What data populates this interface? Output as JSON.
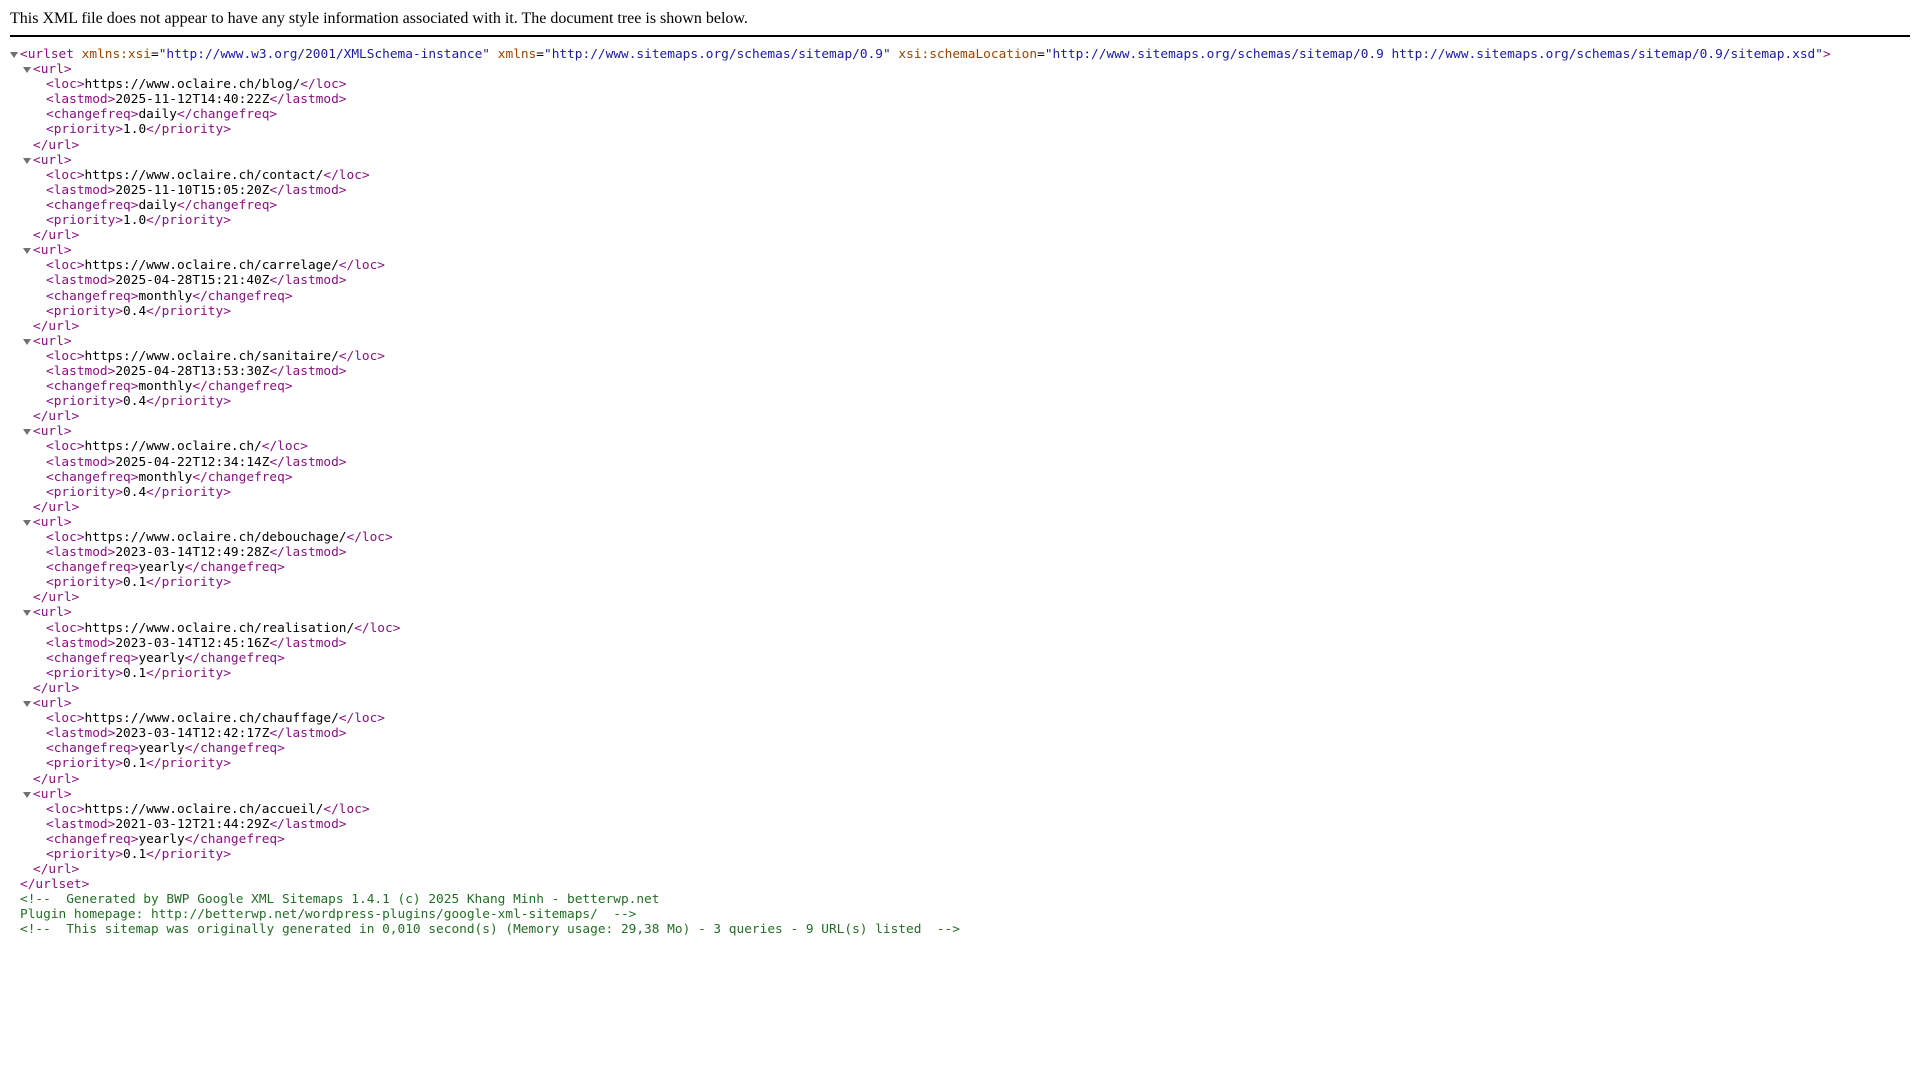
{
  "header": {
    "message": "This XML file does not appear to have any style information associated with it. The document tree is shown below."
  },
  "colors": {
    "tag": "#881280",
    "attribute_name": "#994500",
    "attribute_value": "#1a1aa6",
    "comment": "#236e25",
    "toggle": "#707070"
  },
  "icons": {
    "toggle": "disclosure-triangle-down"
  },
  "urlset": {
    "open_tag": "<urlset",
    "close_tag": "</urlset>",
    "attributes": [
      {
        "name": "xmlns:xsi",
        "value": "\"http://www.w3.org/2001/XMLSchema-instance\""
      },
      {
        "name": "xmlns",
        "value": "\"http://www.sitemaps.org/schemas/sitemap/0.9\""
      },
      {
        "name": "xsi:schemaLocation",
        "value": "\"http://www.sitemaps.org/schemas/sitemap/0.9 http://www.sitemaps.org/schemas/sitemap/0.9/sitemap.xsd\""
      }
    ]
  },
  "urls": [
    {
      "loc": "https://www.oclaire.ch/blog/",
      "lastmod": "2025-11-12T14:40:22Z",
      "changefreq": "daily",
      "priority": "1.0"
    },
    {
      "loc": "https://www.oclaire.ch/contact/",
      "lastmod": "2025-11-10T15:05:20Z",
      "changefreq": "daily",
      "priority": "1.0"
    },
    {
      "loc": "https://www.oclaire.ch/carrelage/",
      "lastmod": "2025-04-28T15:21:40Z",
      "changefreq": "monthly",
      "priority": "0.4"
    },
    {
      "loc": "https://www.oclaire.ch/sanitaire/",
      "lastmod": "2025-04-28T13:53:30Z",
      "changefreq": "monthly",
      "priority": "0.4"
    },
    {
      "loc": "https://www.oclaire.ch/",
      "lastmod": "2025-04-22T12:34:14Z",
      "changefreq": "monthly",
      "priority": "0.4"
    },
    {
      "loc": "https://www.oclaire.ch/debouchage/",
      "lastmod": "2023-03-14T12:49:28Z",
      "changefreq": "yearly",
      "priority": "0.1"
    },
    {
      "loc": "https://www.oclaire.ch/realisation/",
      "lastmod": "2023-03-14T12:45:16Z",
      "changefreq": "yearly",
      "priority": "0.1"
    },
    {
      "loc": "https://www.oclaire.ch/chauffage/",
      "lastmod": "2023-03-14T12:42:17Z",
      "changefreq": "yearly",
      "priority": "0.1"
    },
    {
      "loc": "https://www.oclaire.ch/accueil/",
      "lastmod": "2021-03-12T21:44:29Z",
      "changefreq": "yearly",
      "priority": "0.1"
    }
  ],
  "comments": [
    "<!--  Generated by BWP Google XML Sitemaps 1.4.1 (c) 2025 Khang Minh - betterwp.net",
    "Plugin homepage: http://betterwp.net/wordpress-plugins/google-xml-sitemaps/  -->",
    "<!--  This sitemap was originally generated in 0,010 second(s) (Memory usage: 29,38 Mo) - 3 queries - 9 URL(s) listed  -->"
  ]
}
